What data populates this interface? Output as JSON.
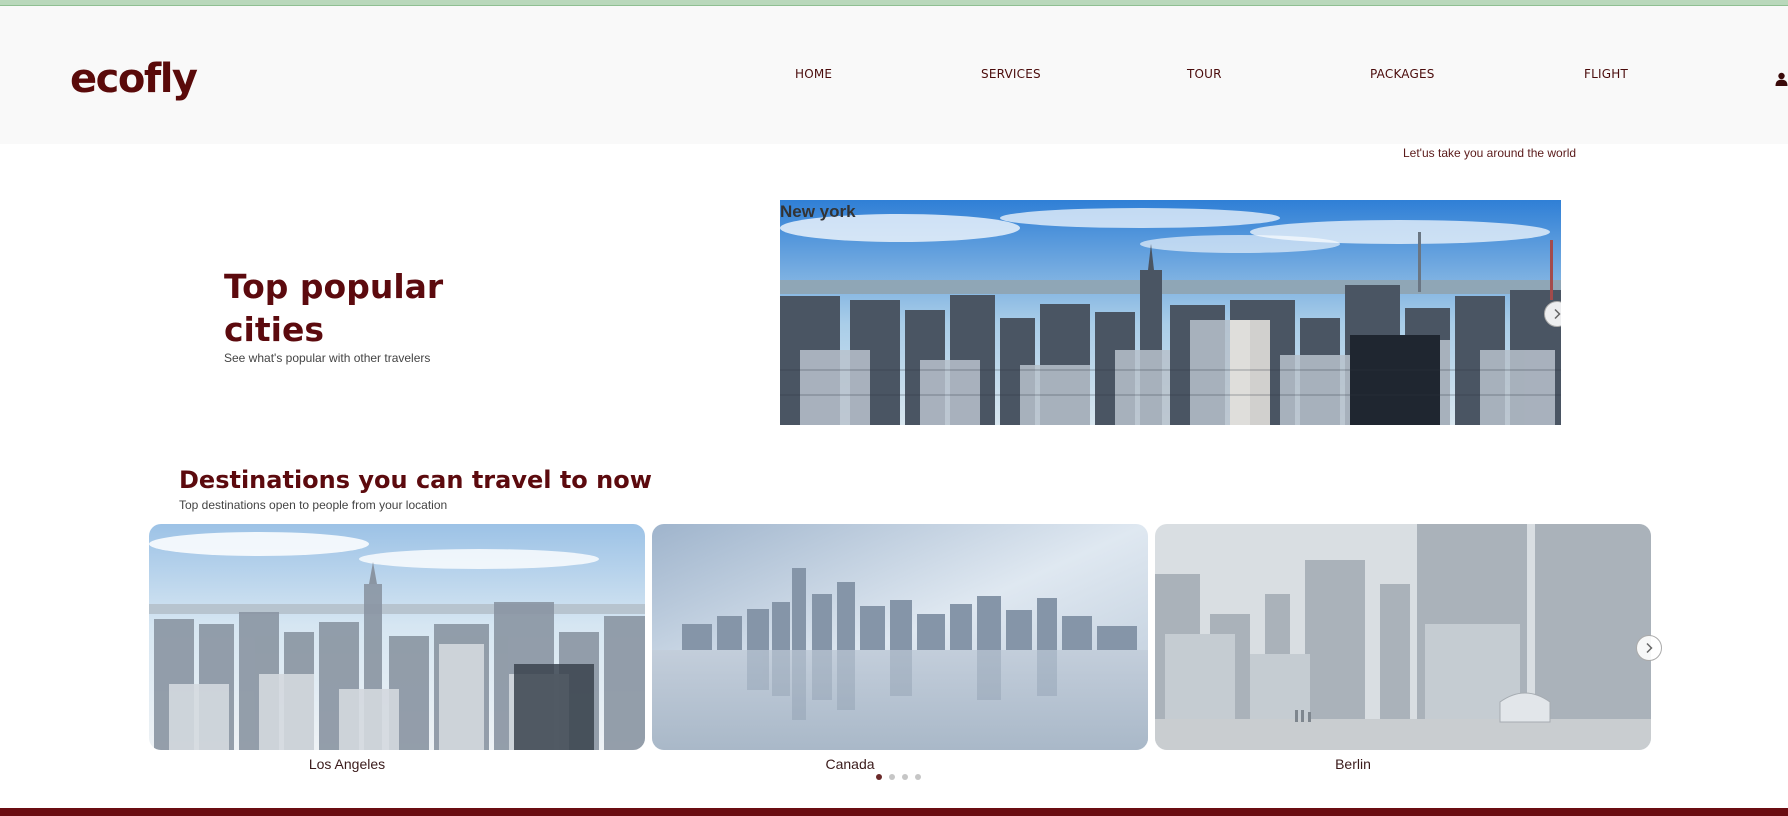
{
  "brand": {
    "logo": "ecofly"
  },
  "nav": {
    "items": [
      {
        "label": "HOME"
      },
      {
        "label": "SERVICES"
      },
      {
        "label": "TOUR"
      },
      {
        "label": "PACKAGES"
      },
      {
        "label": "FLIGHT"
      }
    ]
  },
  "tagline": "Let'us take you around the world",
  "hero": {
    "title": "Top popular cities",
    "subtitle": "See what's popular with other travelers",
    "featured": {
      "label": "New york"
    }
  },
  "destinations": {
    "title": "Destinations you can travel to now",
    "subtitle": "Top destinations open to people from your location",
    "cards": [
      {
        "label": "Los Angeles"
      },
      {
        "label": "Canada"
      },
      {
        "label": "Berlin"
      }
    ],
    "pagination": {
      "count": 4,
      "active": 1
    }
  },
  "colors": {
    "brand": "#5c0a0e",
    "footer": "#6a0d12",
    "header_bg": "#f9f9f9"
  },
  "icons": {
    "user": "user-icon",
    "next": "chevron-right-icon"
  }
}
